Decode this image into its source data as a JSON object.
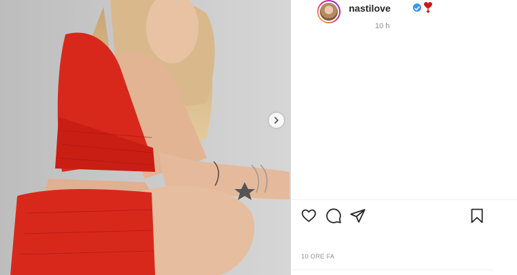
{
  "post": {
    "username": "nastilove",
    "relative_time": "10 h",
    "timestamp": "10 ORE FA"
  },
  "icons": {
    "verified": "verified-badge-icon",
    "emoji": "heart-emoji-icon",
    "like": "heart-outline-icon",
    "comment": "comment-icon",
    "share": "paper-plane-icon",
    "save": "bookmark-icon",
    "next": "chevron-right-icon"
  },
  "colors": {
    "verified": "#3897f0",
    "text_primary": "#262626",
    "text_secondary": "#8e8e8e",
    "dress_red": "#d8281c"
  }
}
